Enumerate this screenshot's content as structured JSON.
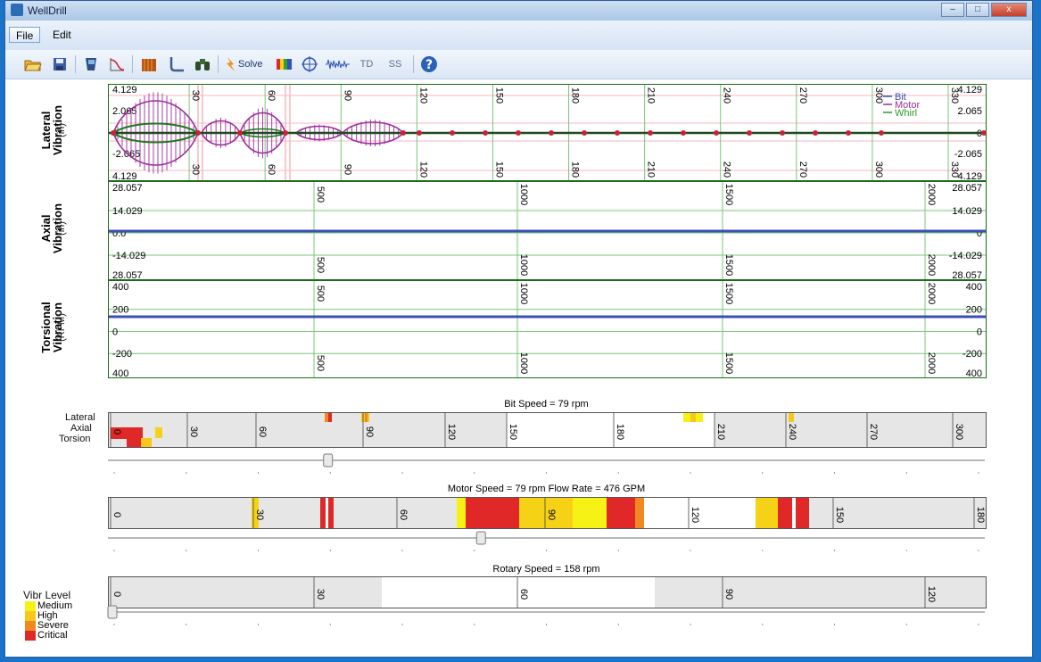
{
  "window": {
    "title": "WellDrill"
  },
  "menu": {
    "file": "File",
    "edit": "Edit"
  },
  "toolbar": {
    "solve_label": "Solve",
    "td_label": "TD",
    "ss_label": "SS"
  },
  "lateral": {
    "label": "Lateral\nVibration",
    "unit": "(in)",
    "y_ticks": [
      "4.129",
      "2.065",
      "0",
      "-2.065",
      "4.129"
    ],
    "y_ticks_left": [
      "4.129",
      "2.065",
      "0",
      "-2.065",
      "4.129"
    ],
    "x_ticks": [
      "30",
      "60",
      "90",
      "120",
      "150",
      "180",
      "210",
      "240",
      "270",
      "300",
      "330"
    ],
    "legend": [
      {
        "name": "Bit",
        "color": "#3c4fb5"
      },
      {
        "name": "Motor",
        "color": "#9b2d9b"
      },
      {
        "name": "Whirl",
        "color": "#2e9a2e"
      }
    ]
  },
  "axial": {
    "label": "Axial\nVibration",
    "unit": "(in)",
    "y_ticks_left": [
      "28.057",
      "14.029",
      "0.0",
      "-14.029",
      "28.057"
    ],
    "y_ticks_right": [
      "28.057",
      "14.029",
      "0",
      "-14.029",
      "28.057"
    ],
    "x_ticks": [
      "500",
      "1000",
      "1500",
      "2000"
    ]
  },
  "torsional": {
    "label": "Torsional\nVibration",
    "unit": "(RPM)",
    "y_ticks_left": [
      "400",
      "200",
      "0",
      "-200",
      "400"
    ],
    "y_ticks_right": [
      "400",
      "200",
      "0",
      "-200",
      "400"
    ],
    "x_ticks": [
      "500",
      "1000",
      "1500",
      "2000"
    ]
  },
  "bit_map": {
    "header": "Bit Speed = 79 rpm",
    "row_labels": [
      "Lateral",
      "Axial",
      "Torsion"
    ],
    "x_ticks": [
      "0",
      "30",
      "60",
      "90",
      "120",
      "150",
      "180",
      "210",
      "240",
      "270",
      "300"
    ],
    "slider_value": 79
  },
  "motor_map": {
    "header": "Motor Speed = 79 rpm   Flow Rate = 476 GPM",
    "x_ticks": [
      "0",
      "30",
      "60",
      "90",
      "120",
      "150",
      "180"
    ],
    "slider_value": 79
  },
  "rotary_map": {
    "header": "Rotary Speed = 158 rpm",
    "x_ticks": [
      "0",
      "30",
      "60",
      "90",
      "120"
    ],
    "slider_value": 0
  },
  "vibr_legend": {
    "title": "Vibr Level",
    "levels": [
      {
        "name": "Medium",
        "color": "#f6f216"
      },
      {
        "name": "High",
        "color": "#f7c81a"
      },
      {
        "name": "Severe",
        "color": "#f08a20"
      },
      {
        "name": "Critical",
        "color": "#e02828"
      }
    ]
  }
}
